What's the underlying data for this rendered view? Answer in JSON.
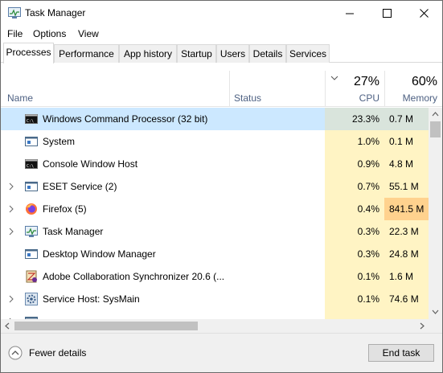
{
  "window": {
    "title": "Task Manager"
  },
  "menu": [
    "File",
    "Options",
    "View"
  ],
  "tabs": [
    "Processes",
    "Performance",
    "App history",
    "Startup",
    "Users",
    "Details",
    "Services"
  ],
  "header": {
    "name": "Name",
    "status": "Status",
    "cpu_pct": "27%",
    "cpu_label": "CPU",
    "mem_pct": "60%",
    "mem_label": "Memory"
  },
  "rows": [
    {
      "name": "Windows Command Processor (32 bit)",
      "cpu": "23.3%",
      "mem": "0.7 M",
      "icon": "cmd-icon",
      "expandable": false,
      "selected": true
    },
    {
      "name": "System",
      "cpu": "1.0%",
      "mem": "0.1 M",
      "icon": "system-icon",
      "expandable": false
    },
    {
      "name": "Console Window Host",
      "cpu": "0.9%",
      "mem": "4.8 M",
      "icon": "console-icon",
      "expandable": false
    },
    {
      "name": "ESET Service (2)",
      "cpu": "0.7%",
      "mem": "55.1 M",
      "icon": "service-icon",
      "expandable": true
    },
    {
      "name": "Firefox (5)",
      "cpu": "0.4%",
      "mem": "841.5 M",
      "icon": "firefox-icon",
      "expandable": true,
      "mem_hot": true
    },
    {
      "name": "Task Manager",
      "cpu": "0.3%",
      "mem": "22.3 M",
      "icon": "task-manager-icon",
      "expandable": true
    },
    {
      "name": "Desktop Window Manager",
      "cpu": "0.3%",
      "mem": "24.8 M",
      "icon": "window-manager-icon",
      "expandable": false
    },
    {
      "name": "Adobe Collaboration Synchronizer 20.6 (...",
      "cpu": "0.1%",
      "mem": "1.6 M",
      "icon": "adobe-icon",
      "expandable": false
    },
    {
      "name": "Service Host: SysMain",
      "cpu": "0.1%",
      "mem": "74.6 M",
      "icon": "gear-icon",
      "expandable": true
    },
    {
      "name": "",
      "cpu": "",
      "mem": "",
      "icon": "app-icon",
      "expandable": true
    }
  ],
  "footer": {
    "fewer_details": "Fewer details",
    "end_task": "End task"
  },
  "colors": {
    "selected_row": "#cce8ff",
    "heat_low": "#fff4c4",
    "heat_high": "#ffd28e",
    "header_text": "#4d6082"
  }
}
